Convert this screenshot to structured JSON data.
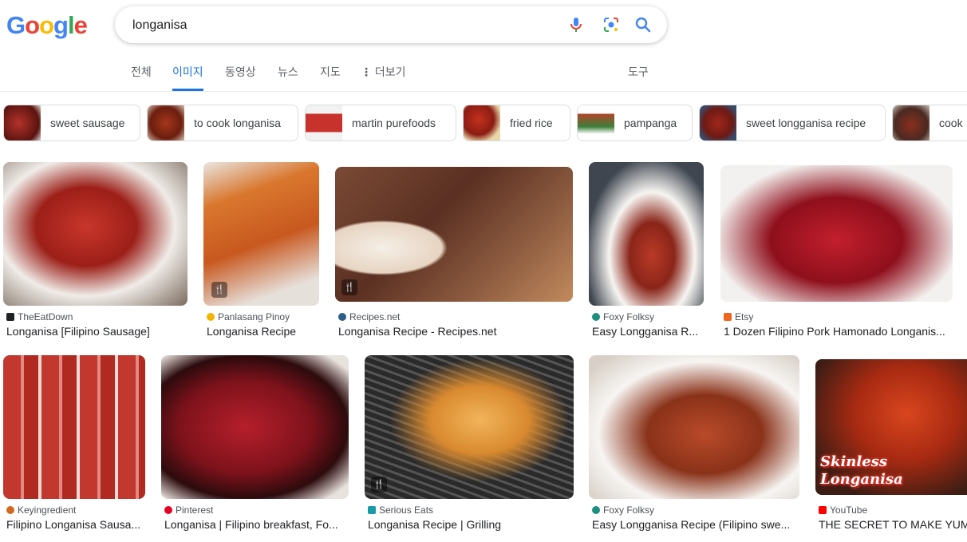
{
  "logo": {
    "letters": [
      "G",
      "o",
      "o",
      "g",
      "l",
      "e"
    ],
    "colors": [
      "#4285f4",
      "#ea4335",
      "#fbbc05",
      "#4285f4",
      "#34a853",
      "#ea4335"
    ]
  },
  "search": {
    "query": "longanisa",
    "icons": [
      "mic-icon",
      "lens-icon",
      "search-icon"
    ]
  },
  "tabs": [
    {
      "label": "전체",
      "active": false
    },
    {
      "label": "이미지",
      "active": true
    },
    {
      "label": "동영상",
      "active": false
    },
    {
      "label": "뉴스",
      "active": false
    },
    {
      "label": "지도",
      "active": false
    },
    {
      "label": "더보기",
      "active": false
    }
  ],
  "tools_label": "도구",
  "chips": [
    {
      "label": "sweet sausage"
    },
    {
      "label": "to cook longanisa"
    },
    {
      "label": "martin purefoods"
    },
    {
      "label": "fried rice"
    },
    {
      "label": "pampanga"
    },
    {
      "label": "sweet longganisa recipe"
    },
    {
      "label": "cook"
    }
  ],
  "results": [
    {
      "source": "TheEatDown",
      "title": "Longanisa [Filipino Sausage]",
      "fav_color": "#202124"
    },
    {
      "source": "Panlasang Pinoy",
      "title": "Longanisa Recipe",
      "fav_color": "#f4b400"
    },
    {
      "source": "Recipes.net",
      "title": "Longanisa Recipe - Recipes.net",
      "fav_color": "#2b5f8a"
    },
    {
      "source": "Foxy Folksy",
      "title": "Easy Longganisa R...",
      "fav_color": "#1e8e7e"
    },
    {
      "source": "Etsy",
      "title": "1 Dozen Filipino Pork Hamonado Longanis...",
      "fav_color": "#f1641e"
    },
    {
      "source": "Keyingredient",
      "title": "Filipino Longanisa Sausa...",
      "fav_color": "#d2691e"
    },
    {
      "source": "Pinterest",
      "title": "Longanisa | Filipino breakfast, Fo...",
      "fav_color": "#e60023"
    },
    {
      "source": "Serious Eats",
      "title": "Longanisa Recipe | Grilling",
      "fav_color": "#1a9ba8"
    },
    {
      "source": "Foxy Folksy",
      "title": "Easy Longganisa Recipe (Filipino swe...",
      "fav_color": "#1e8e7e"
    },
    {
      "source": "YouTube",
      "title": "THE SECRET TO MAKE YUMMY...",
      "fav_color": "#ff0000"
    }
  ],
  "recipe_badge": "🍴",
  "overlay": {
    "line1": "Skinless",
    "line2": "Longanisa"
  }
}
